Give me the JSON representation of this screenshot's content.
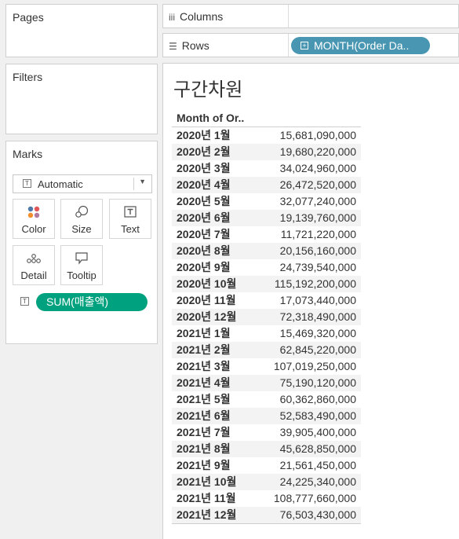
{
  "cards": {
    "pages": "Pages",
    "filters": "Filters",
    "marks": "Marks"
  },
  "marks": {
    "mark_type": "Automatic",
    "buttons": [
      {
        "label": "Color",
        "icon": "color-dots-icon"
      },
      {
        "label": "Size",
        "icon": "size-circles-icon"
      },
      {
        "label": "Text",
        "icon": "text-t-icon"
      },
      {
        "label": "Detail",
        "icon": "detail-dots-icon"
      },
      {
        "label": "Tooltip",
        "icon": "tooltip-bubble-icon"
      }
    ],
    "pill": "SUM(매출액)"
  },
  "shelves": {
    "columns": "Columns",
    "rows": "Rows",
    "rows_pill": "MONTH(Order Da.."
  },
  "view": {
    "title": "구간차원",
    "column_header": "Month of Or..",
    "rows": [
      {
        "month": "2020년 1월",
        "amount": "15,681,090,000"
      },
      {
        "month": "2020년 2월",
        "amount": "19,680,220,000"
      },
      {
        "month": "2020년 3월",
        "amount": "34,024,960,000"
      },
      {
        "month": "2020년 4월",
        "amount": "26,472,520,000"
      },
      {
        "month": "2020년 5월",
        "amount": "32,077,240,000"
      },
      {
        "month": "2020년 6월",
        "amount": "19,139,760,000"
      },
      {
        "month": "2020년 7월",
        "amount": "11,721,220,000"
      },
      {
        "month": "2020년 8월",
        "amount": "20,156,160,000"
      },
      {
        "month": "2020년 9월",
        "amount": "24,739,540,000"
      },
      {
        "month": "2020년 10월",
        "amount": "115,192,200,000"
      },
      {
        "month": "2020년 11월",
        "amount": "17,073,440,000"
      },
      {
        "month": "2020년 12월",
        "amount": "72,318,490,000"
      },
      {
        "month": "2021년 1월",
        "amount": "15,469,320,000"
      },
      {
        "month": "2021년 2월",
        "amount": "62,845,220,000"
      },
      {
        "month": "2021년 3월",
        "amount": "107,019,250,000"
      },
      {
        "month": "2021년 4월",
        "amount": "75,190,120,000"
      },
      {
        "month": "2021년 5월",
        "amount": "60,362,860,000"
      },
      {
        "month": "2021년 6월",
        "amount": "52,583,490,000"
      },
      {
        "month": "2021년 7월",
        "amount": "39,905,400,000"
      },
      {
        "month": "2021년 8월",
        "amount": "45,628,850,000"
      },
      {
        "month": "2021년 9월",
        "amount": "21,561,450,000"
      },
      {
        "month": "2021년 10월",
        "amount": "24,225,340,000"
      },
      {
        "month": "2021년 11월",
        "amount": "108,777,660,000"
      },
      {
        "month": "2021년 12월",
        "amount": "76,503,430,000"
      }
    ]
  },
  "colors": {
    "rows_pill": "#4996b2",
    "measure_pill": "#00a17e"
  }
}
